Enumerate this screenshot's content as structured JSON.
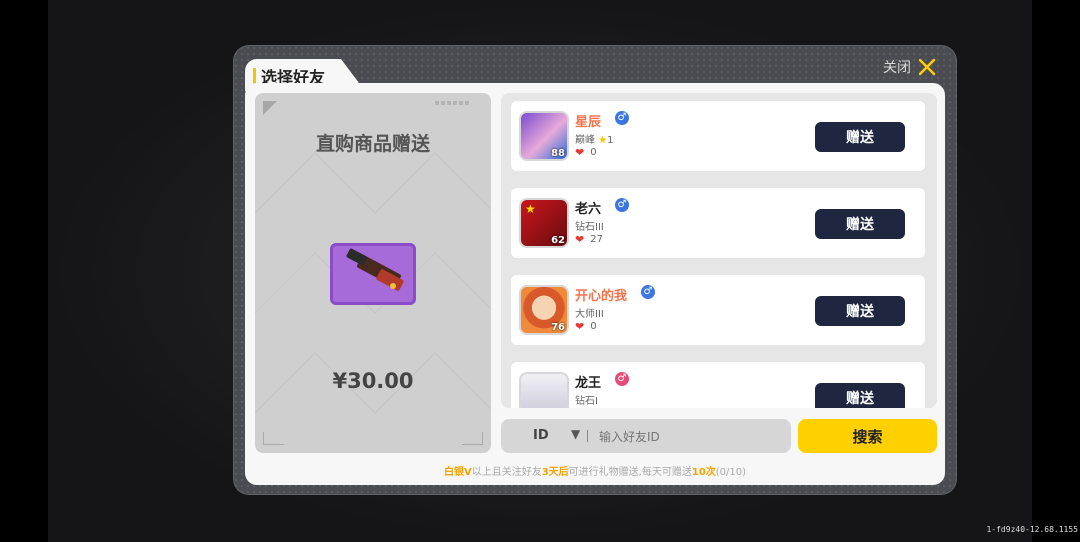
{
  "dialog": {
    "tab_title": "选择好友",
    "close_label": "关闭",
    "accent_color": "#ffd000"
  },
  "product": {
    "title": "直购商品赠送",
    "price": "¥30.00",
    "item_icon": "weapon-skin-icon"
  },
  "friends": [
    {
      "name": "星辰",
      "name_color": "#f4744e",
      "gender": "male",
      "rank": "巅峰",
      "star_count": "1",
      "level": "88",
      "hearts": "0"
    },
    {
      "name": "老六",
      "name_color": "#222222",
      "gender": "male",
      "rank": "钻石III",
      "level": "62",
      "hearts": "27"
    },
    {
      "name": "开心的我",
      "name_color": "#f4744e",
      "gender": "male",
      "rank": "大师III",
      "level": "76",
      "hearts": "0"
    },
    {
      "name": "龙王",
      "name_color": "#222222",
      "gender": "female",
      "rank": "钻石I",
      "level": "",
      "hearts": ""
    }
  ],
  "gift_button_label": "赠送",
  "search": {
    "type_value": "ID",
    "placeholder": "输入好友ID",
    "button_label": "搜索"
  },
  "notice": {
    "part1": "白银V",
    "part2": "以上且关注好友",
    "part3": "3天后",
    "part4": "可进行礼物赠送,每天可赠送",
    "part5": "10次",
    "part6": "(0/10)"
  },
  "version": "1-fd9z40-12.68.1155"
}
